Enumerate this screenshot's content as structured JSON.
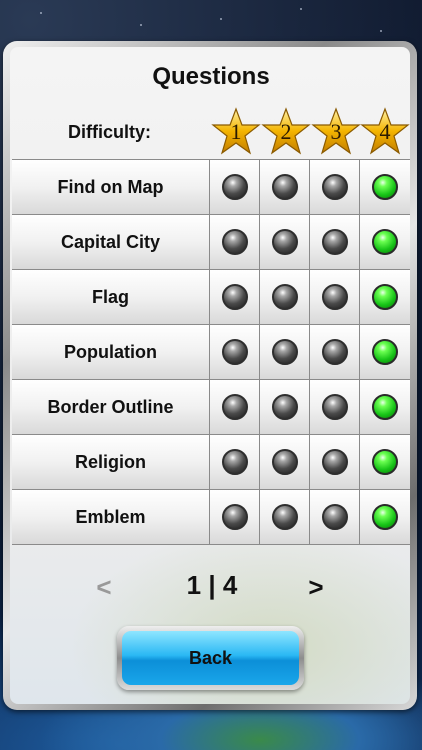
{
  "screen": {
    "title": "Questions",
    "difficulty_label": "Difficulty:",
    "difficulty_levels": [
      "1",
      "2",
      "3",
      "4"
    ]
  },
  "question_types": [
    {
      "label": "Find on Map",
      "selected_level": 4
    },
    {
      "label": "Capital City",
      "selected_level": 4
    },
    {
      "label": "Flag",
      "selected_level": 4
    },
    {
      "label": "Population",
      "selected_level": 4
    },
    {
      "label": "Border Outline",
      "selected_level": 4
    },
    {
      "label": "Religion",
      "selected_level": 4
    },
    {
      "label": "Emblem",
      "selected_level": 4
    }
  ],
  "pager": {
    "prev_label": "<",
    "page_text": "1 | 4",
    "next_label": ">"
  },
  "back_button": {
    "label": "Back"
  },
  "colors": {
    "led_on": "#18c418",
    "led_off": "#4a4a4a",
    "star_gold": "#f4b400",
    "button_blue": "#1aa6ea"
  },
  "icons": {
    "difficulty_star": "star-icon",
    "led": "indicator-light-icon"
  }
}
